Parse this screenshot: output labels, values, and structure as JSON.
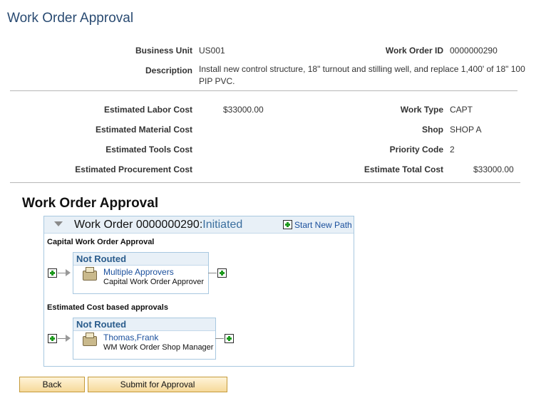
{
  "page": {
    "title": "Work Order Approval"
  },
  "header": {
    "business_unit_label": "Business Unit",
    "business_unit": "US001",
    "work_order_id_label": "Work Order ID",
    "work_order_id": "0000000290",
    "description_label": "Description",
    "description_line1": "Install new control structure, 18\" turnout and stilling well, and replace 1,400' of 18\" 100",
    "description_line2": "PIP PVC."
  },
  "details": {
    "est_labor_label": "Estimated Labor Cost",
    "est_labor": "$33000.00",
    "est_material_label": "Estimated Material Cost",
    "est_tools_label": "Estimated Tools Cost",
    "est_procurement_label": "Estimated Procurement Cost",
    "work_type_label": "Work Type",
    "work_type": "CAPT",
    "shop_label": "Shop",
    "shop": "SHOP A",
    "priority_label": "Priority Code",
    "priority": "2",
    "est_total_label": "Estimate Total Cost",
    "est_total": "$33000.00"
  },
  "approval": {
    "section_title": "Work Order Approval",
    "header_prefix": "Work Order 0000000290:",
    "header_status": "Initiated",
    "start_new_path": "Start New Path",
    "paths": [
      {
        "label": "Capital Work Order Approval",
        "status": "Not Routed",
        "approver": "Multiple Approvers",
        "role": "Capital Work Order Approver"
      },
      {
        "label": "Estimated Cost based approvals",
        "status": "Not Routed",
        "approver": "Thomas,Frank",
        "role": "WM Work Order Shop Manager"
      }
    ]
  },
  "buttons": {
    "back": "Back",
    "submit": "Submit for Approval"
  },
  "colors": {
    "title": "#2a4b72",
    "link": "#1a4f9c",
    "panel_header_bg": "#e8f0f7",
    "button_bg": "#f6d99a"
  }
}
